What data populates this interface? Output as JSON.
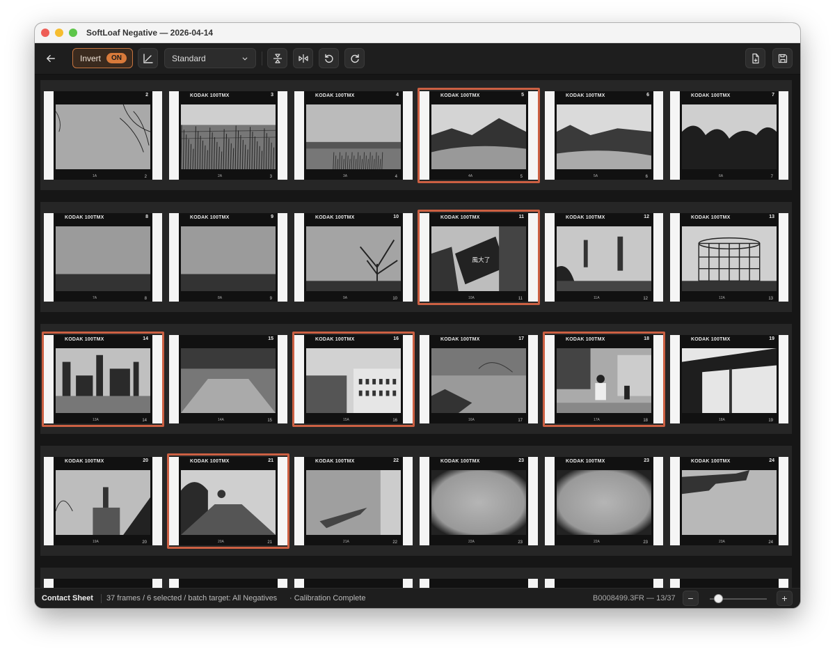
{
  "window": {
    "title": "SoftLoaf Negative — 2026-04-14"
  },
  "toolbar": {
    "invert_label": "Invert",
    "invert_state": "ON",
    "profile_selected": "Standard"
  },
  "film": {
    "stock": "KODAK 100TMX"
  },
  "rows": [
    [
      {
        "num": "2",
        "sub": "1A",
        "sub2": "2",
        "label": false,
        "selected": false,
        "scene": "branches"
      },
      {
        "num": "3",
        "sub": "2A",
        "sub2": "3",
        "label": true,
        "selected": false,
        "scene": "reeds"
      },
      {
        "num": "4",
        "sub": "3A",
        "sub2": "4",
        "label": true,
        "selected": false,
        "scene": "lake"
      },
      {
        "num": "5",
        "sub": "4A",
        "sub2": "5",
        "label": true,
        "selected": true,
        "scene": "river"
      },
      {
        "num": "6",
        "sub": "5A",
        "sub2": "6",
        "label": true,
        "selected": false,
        "scene": "river2"
      },
      {
        "num": "7",
        "sub": "6A",
        "sub2": "7",
        "label": true,
        "selected": false,
        "scene": "treeline"
      }
    ],
    [
      {
        "num": "8",
        "sub": "7A",
        "sub2": "8",
        "label": true,
        "selected": false,
        "scene": "flat"
      },
      {
        "num": "9",
        "sub": "8A",
        "sub2": "9",
        "label": true,
        "selected": false,
        "scene": "flat"
      },
      {
        "num": "10",
        "sub": "9A",
        "sub2": "10",
        "label": true,
        "selected": false,
        "scene": "tree"
      },
      {
        "num": "11",
        "sub": "10A",
        "sub2": "11",
        "label": true,
        "selected": true,
        "scene": "sign"
      },
      {
        "num": "12",
        "sub": "11A",
        "sub2": "12",
        "label": true,
        "selected": false,
        "scene": "chimney"
      },
      {
        "num": "13",
        "sub": "12A",
        "sub2": "13",
        "label": true,
        "selected": false,
        "scene": "gasholder"
      }
    ],
    [
      {
        "num": "14",
        "sub": "13A",
        "sub2": "14",
        "label": true,
        "selected": true,
        "scene": "factory"
      },
      {
        "num": "15",
        "sub": "14A",
        "sub2": "15",
        "label": false,
        "selected": false,
        "scene": "yard"
      },
      {
        "num": "16",
        "sub": "15A",
        "sub2": "16",
        "label": true,
        "selected": true,
        "scene": "buildings"
      },
      {
        "num": "17",
        "sub": "16A",
        "sub2": "17",
        "label": true,
        "selected": false,
        "scene": "shadow"
      },
      {
        "num": "18",
        "sub": "17A",
        "sub2": "18",
        "label": true,
        "selected": true,
        "scene": "people"
      },
      {
        "num": "19",
        "sub": "18A",
        "sub2": "19",
        "label": true,
        "selected": false,
        "scene": "steel"
      }
    ],
    [
      {
        "num": "20",
        "sub": "19A",
        "sub2": "20",
        "label": true,
        "selected": false,
        "scene": "industry"
      },
      {
        "num": "21",
        "sub": "20A",
        "sub2": "21",
        "label": true,
        "selected": true,
        "scene": "garden"
      },
      {
        "num": "22",
        "sub": "21A",
        "sub2": "22",
        "label": true,
        "selected": false,
        "scene": "wing"
      },
      {
        "num": "23",
        "sub": "22A",
        "sub2": "23",
        "label": true,
        "selected": false,
        "scene": "clouds"
      },
      {
        "num": "23",
        "sub": "22A",
        "sub2": "23",
        "label": true,
        "selected": false,
        "scene": "clouds"
      },
      {
        "num": "24",
        "sub": "23A",
        "sub2": "24",
        "label": true,
        "selected": false,
        "scene": "wing2"
      }
    ]
  ],
  "status": {
    "view": "Contact Sheet",
    "info": "37 frames / 6 selected / batch target: All Negatives",
    "calibration": "· Calibration Complete",
    "file": "B0008499.3FR — 13/37",
    "zoom_level": 0.15
  }
}
